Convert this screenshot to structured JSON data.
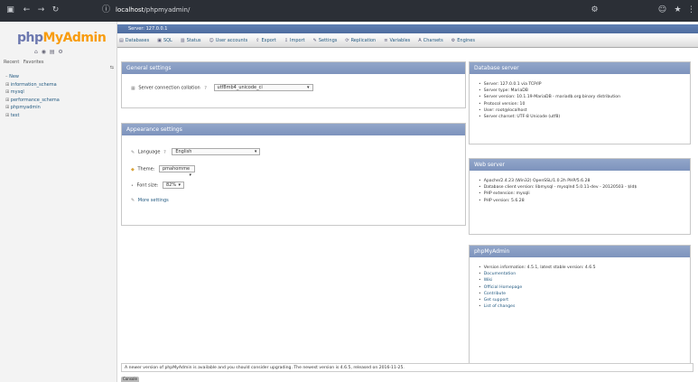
{
  "browser": {
    "url_host": "localhost",
    "url_path": "/phpmyadmin/"
  },
  "sidebar": {
    "logo_php": "php",
    "logo_myadmin": "MyAdmin",
    "nav_icons": "⌂ ◉ ▤ ⚙",
    "recent_label": "Recent",
    "favorites_label": "Favorites",
    "new_label": "New",
    "databases": [
      {
        "name": "information_schema"
      },
      {
        "name": "mysql"
      },
      {
        "name": "performance_schema"
      },
      {
        "name": "phpmyadmin"
      },
      {
        "name": "test"
      }
    ]
  },
  "main": {
    "breadcrumb": "Server: 127.0.0.1",
    "tabs": [
      {
        "label": "Databases",
        "icon": "▤"
      },
      {
        "label": "SQL",
        "icon": "▣"
      },
      {
        "label": "Status",
        "icon": "▥"
      },
      {
        "label": "User accounts",
        "icon": "☺"
      },
      {
        "label": "Export",
        "icon": "⇧"
      },
      {
        "label": "Import",
        "icon": "⇩"
      },
      {
        "label": "Settings",
        "icon": "✎"
      },
      {
        "label": "Replication",
        "icon": "⟳"
      },
      {
        "label": "Variables",
        "icon": "≡"
      },
      {
        "label": "Charsets",
        "icon": "A"
      },
      {
        "label": "Engines",
        "icon": "⚙"
      }
    ],
    "general": {
      "title": "General settings",
      "collation_label": "Server connection collation",
      "collation_value": "utf8mb4_unicode_ci"
    },
    "appearance": {
      "title": "Appearance settings",
      "language_label": "Language",
      "language_value": "English",
      "theme_label": "Theme:",
      "theme_value": "pmahomme",
      "fontsize_label": "Font size:",
      "fontsize_value": "82%",
      "more_settings": "More settings"
    },
    "database_server": {
      "title": "Database server",
      "items": [
        "Server: 127.0.0.1 via TCP/IP",
        "Server type: MariaDB",
        "Server version: 10.1.19-MariaDB - mariadb.org binary distribution",
        "Protocol version: 10",
        "User: root@localhost",
        "Server charset: UTF-8 Unicode (utf8)"
      ]
    },
    "web_server": {
      "title": "Web server",
      "items": [
        "Apache/2.4.23 (Win32) OpenSSL/1.0.2h PHP/5.6.28",
        "Database client version: libmysql - mysqlnd 5.0.11-dev - 20120503 - $Id$",
        "PHP extension: mysqli",
        "PHP version: 5.6.28"
      ]
    },
    "phpmyadmin_panel": {
      "title": "phpMyAdmin",
      "items": [
        {
          "text": "Version information: 4.5.1, latest stable version: 4.6.5",
          "link": false
        },
        {
          "text": "Documentation",
          "link": true
        },
        {
          "text": "Wiki",
          "link": true
        },
        {
          "text": "Official Homepage",
          "link": true
        },
        {
          "text": "Contribute",
          "link": true
        },
        {
          "text": "Get support",
          "link": true
        },
        {
          "text": "List of changes",
          "link": true
        }
      ]
    },
    "notice": "A newer version of phpMyAdmin is available and you should consider upgrading. The newest version is 4.6.5, released on 2016-11-25.",
    "console_label": "Console"
  }
}
